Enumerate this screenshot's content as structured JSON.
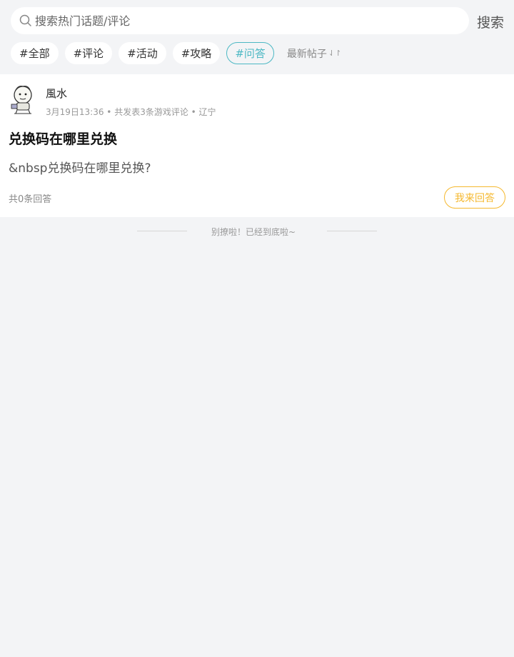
{
  "search": {
    "placeholder": "搜索热门话题/评论",
    "value": "",
    "button_label": "搜索",
    "icon": "search-icon"
  },
  "tags": [
    {
      "label": "#全部",
      "active": false
    },
    {
      "label": "#评论",
      "active": false
    },
    {
      "label": "#活动",
      "active": false
    },
    {
      "label": "#攻略",
      "active": false
    },
    {
      "label": "#问答",
      "active": true
    }
  ],
  "sort": {
    "label": "最新帖子",
    "icon": "sort-arrows-icon"
  },
  "post": {
    "author": "風水",
    "meta": "3月19日13:36 • 共发表3条游戏评论 • 辽宁",
    "title": "兑换码在哪里兑换",
    "body": "&nbsp兑换码在哪里兑换?",
    "answers_count": "共0条回答",
    "answer_button": "我来回答"
  },
  "footer": {
    "end_text": "别撩啦！已经到底啦~"
  },
  "colors": {
    "background": "#f3f4f6",
    "active_tag": "#4cb8c4",
    "answer_accent": "#f5b82e"
  }
}
